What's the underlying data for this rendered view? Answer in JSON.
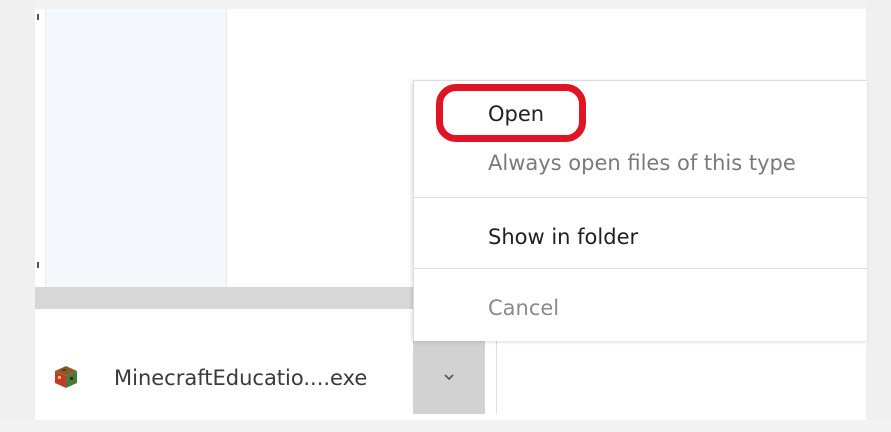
{
  "download_bar": {
    "file_name": "MinecraftEducatio....exe",
    "file_icon": "minecraft-app-icon",
    "more_options_icon": "chevron-down-icon"
  },
  "context_menu": {
    "items": [
      {
        "label": "Open",
        "enabled": true
      },
      {
        "label": "Always open files of this type",
        "enabled": false
      },
      {
        "label": "Show in folder",
        "enabled": true
      },
      {
        "label": "Cancel",
        "enabled": false
      }
    ]
  },
  "colors": {
    "highlight": "#e01422",
    "chevron_button": "#d2d2d2",
    "separator": "#d7d7d7"
  }
}
